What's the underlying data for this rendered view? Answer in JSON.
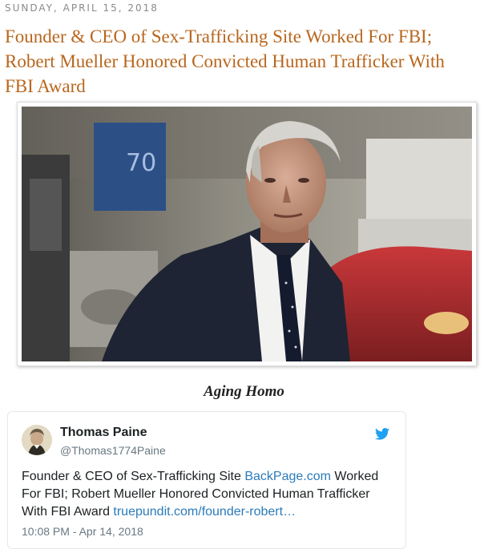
{
  "post": {
    "date": "SUNDAY, APRIL 15, 2018",
    "title": "Founder & CEO of Sex-Trafficking Site Worked For FBI; Robert Mueller Honored Convicted Human Trafficker With FBI Award",
    "caption": "Aging Homo"
  },
  "tweet": {
    "author_name": "Thomas Paine",
    "author_handle": "@Thomas1774Paine",
    "text_part1": "Founder & CEO of Sex-Trafficking Site ",
    "link1": "BackPage.com",
    "text_part2": " Worked For FBI; Robert Mueller Honored Convicted Human Trafficker With FBI Award ",
    "link2": "truepundit.com/founder-robert…",
    "timestamp": "10:08 PM - Apr 14, 2018",
    "icon": "twitter-bird-icon"
  },
  "colors": {
    "title": "#b8661d",
    "link": "#2b7bb9",
    "twitter_blue": "#1da1f2"
  }
}
